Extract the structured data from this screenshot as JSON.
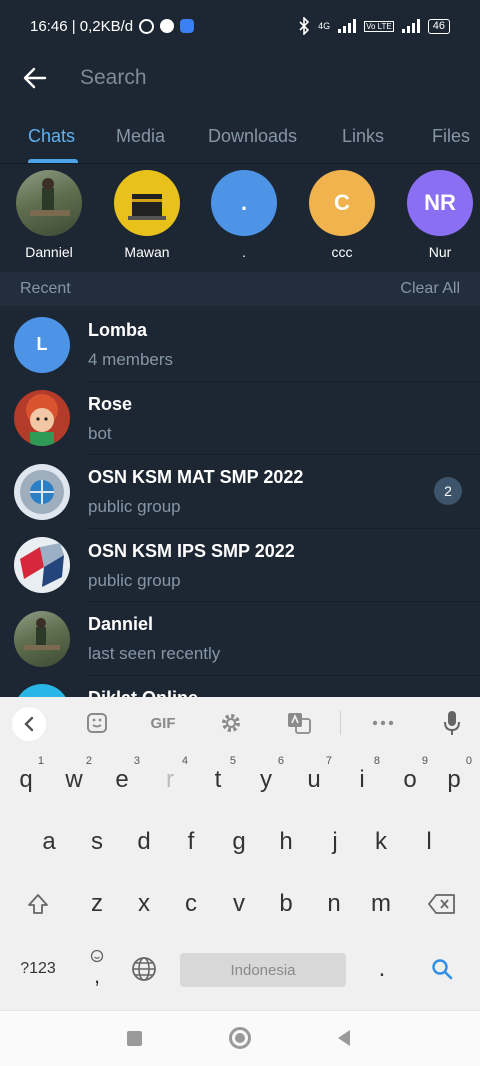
{
  "status_bar": {
    "time_speed": "16:46 | 0,2KB/d",
    "network_label": "4G",
    "volte_label": "Vo LTE",
    "battery": "46"
  },
  "search": {
    "placeholder": "Search"
  },
  "tabs": [
    {
      "label": "Chats",
      "active": true
    },
    {
      "label": "Media",
      "active": false
    },
    {
      "label": "Downloads",
      "active": false
    },
    {
      "label": "Links",
      "active": false
    },
    {
      "label": "Files",
      "active": false
    }
  ],
  "top_people": [
    {
      "name": "Danniel",
      "initials": "",
      "color": "#6b7b52"
    },
    {
      "name": "Mawan",
      "initials": "",
      "color": "#e8c21a"
    },
    {
      "name": ".",
      "initials": ".",
      "color": "#4d94e6"
    },
    {
      "name": "ccc",
      "initials": "C",
      "color": "#f0b34e"
    },
    {
      "name": "Nur",
      "initials": "NR",
      "color": "#8a6ff2"
    }
  ],
  "recent": {
    "title": "Recent",
    "clear_label": "Clear All"
  },
  "chats": [
    {
      "name": "Lomba",
      "subtitle": "4 members",
      "initials": "L",
      "color": "#4d94e6",
      "badge": ""
    },
    {
      "name": "Rose",
      "subtitle": "bot",
      "initials": "",
      "color": "#c2442f",
      "badge": ""
    },
    {
      "name": "OSN KSM MAT SMP 2022",
      "subtitle": "public group",
      "initials": "",
      "color": "#dfe6ee",
      "badge": "2"
    },
    {
      "name": "OSN KSM IPS SMP 2022",
      "subtitle": "public group",
      "initials": "",
      "color": "#e9eef2",
      "badge": ""
    },
    {
      "name": "Danniel",
      "subtitle": "last seen recently",
      "initials": "",
      "color": "#6b7b52",
      "badge": ""
    },
    {
      "name": "Diklat Online",
      "subtitle": "",
      "initials": "",
      "color": "#29b6e6",
      "badge": ""
    }
  ],
  "keyboard": {
    "toolbar": {
      "gif_label": "GIF"
    },
    "row1": [
      {
        "key": "q",
        "hint": "1"
      },
      {
        "key": "w",
        "hint": "2"
      },
      {
        "key": "e",
        "hint": "3"
      },
      {
        "key": "r",
        "hint": "4"
      },
      {
        "key": "t",
        "hint": "5"
      },
      {
        "key": "y",
        "hint": "6"
      },
      {
        "key": "u",
        "hint": "7"
      },
      {
        "key": "i",
        "hint": "8"
      },
      {
        "key": "o",
        "hint": "9"
      },
      {
        "key": "p",
        "hint": "0"
      }
    ],
    "row2": [
      "a",
      "s",
      "d",
      "f",
      "g",
      "h",
      "j",
      "k",
      "l"
    ],
    "row3": [
      "z",
      "x",
      "c",
      "v",
      "b",
      "n",
      "m"
    ],
    "symbols_label": "?123",
    "comma_label": ",",
    "space_label": "Indonesia",
    "period_label": "."
  }
}
